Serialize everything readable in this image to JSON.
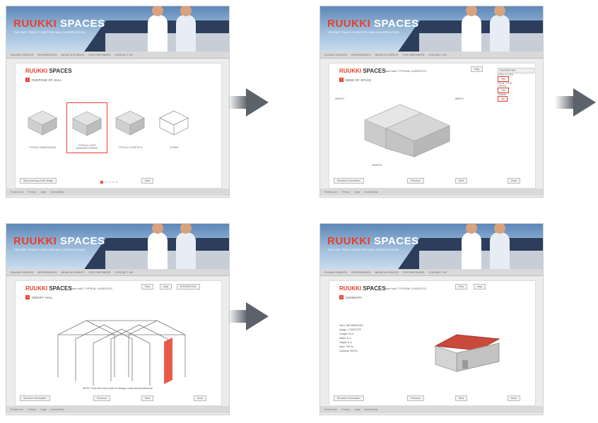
{
  "header": {
    "logo_brand": "RUUKKI",
    "logo_suffix": "SPACES",
    "tagline": "THE FAST TRACK TO BETTER HALL CONSTRUCTION"
  },
  "nav": [
    "RUUKKI SPACES",
    "REFERENCES",
    "NEWS & EVENTS",
    "FOR PARTNERS",
    "CONTACT US"
  ],
  "footer": [
    "Ruukki.com",
    "Privacy",
    "Legal",
    "Accessibility"
  ],
  "screen1": {
    "title_brand": "RUUKKI",
    "title_suffix": "SPACES",
    "step": "1",
    "section": "PURPOSE OF HALL",
    "cards": [
      "TYPICAL WAREHOUSE",
      "TYPICAL LIGHT MANUFACTURING",
      "TYPICAL LOGISTICS",
      "OTHER"
    ],
    "bottom_left": "Start planning a hall design",
    "pages": [
      "1",
      "2",
      "3",
      "4",
      "5"
    ],
    "next": "Next"
  },
  "screen2": {
    "title_brand": "RUUKKI",
    "title_suffix": "SPACES",
    "hall": "Own hall 1 TYPICAL LOGISTICS",
    "step": "2",
    "section": "NEED OF SPACE",
    "height_label": "HEIGHT",
    "width_label": "WIDTH",
    "length_label": "LENGTH",
    "help": "Help",
    "properties": "PROPERTIES",
    "props": [
      "AREA STOPS",
      "ROOF TYPE",
      "OFFICE",
      "CRANE"
    ],
    "yes": "Yes",
    "no": "No",
    "prev": "Previous",
    "next": "Next",
    "download": "Structure information",
    "done": "Done"
  },
  "screen3": {
    "title_brand": "RUUKKI",
    "title_suffix": "SPACES",
    "hall": "Own hall 1 TYPICAL LOGISTICS",
    "step": "3",
    "section": "MODIFY HALL",
    "help": "Help",
    "print": "Print",
    "properties": "PROPERTIES",
    "note": "NOTE: Point and click model to change constructional elements",
    "download": "Structure information",
    "prev": "Previous",
    "next": "Next",
    "done": "Done"
  },
  "screen4": {
    "title_brand": "RUUKKI",
    "title_suffix": "SPACES",
    "hall": "Own hall 1 TYPICAL LOGISTICS",
    "step": "4",
    "section": "SUMMARY",
    "info_title": "HALL INFORMATION",
    "info_lines": [
      "Usage: LOGISTICS",
      "Length: 40 m",
      "Width: 8 m",
      "Height: 8 m",
      "Area: 795 m²",
      "Capacity: 800 m³"
    ],
    "help": "Help",
    "print": "Print",
    "download": "Structure information",
    "prev": "Previous",
    "next": "Next",
    "done": "Done"
  },
  "colors": {
    "accent": "#e8402a",
    "arrow": "#5c6269"
  }
}
